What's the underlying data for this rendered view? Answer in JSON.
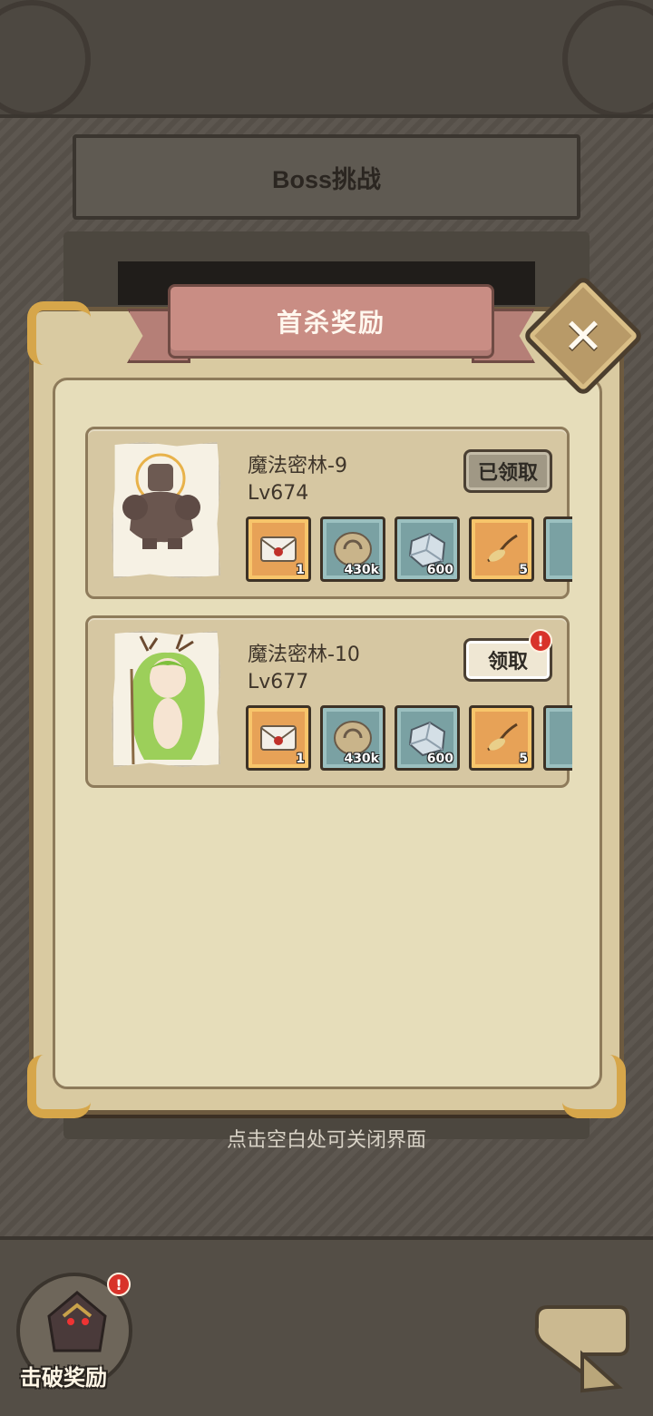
{
  "header": {
    "title": "Boss挑战"
  },
  "modal": {
    "title": "首杀奖励",
    "close_icon": "close-icon",
    "hint": "点击空白处可关闭界面"
  },
  "rewards": [
    {
      "stage": "魔法密林-9",
      "level": "Lv674",
      "button": "已领取",
      "state": "claimed",
      "boss": "stone-golem",
      "items": [
        {
          "icon": "letter-icon",
          "count": "1",
          "frame": "gold"
        },
        {
          "icon": "coin-icon",
          "count": "430k",
          "frame": "teal"
        },
        {
          "icon": "crystal-icon",
          "count": "600",
          "frame": "teal"
        },
        {
          "icon": "root-icon",
          "count": "5",
          "frame": "gold"
        }
      ]
    },
    {
      "stage": "魔法密林-10",
      "level": "Lv677",
      "button": "领取",
      "state": "claimable",
      "badge": "!",
      "boss": "forest-dryad",
      "items": [
        {
          "icon": "letter-icon",
          "count": "1",
          "frame": "gold"
        },
        {
          "icon": "coin-icon",
          "count": "430k",
          "frame": "teal"
        },
        {
          "icon": "crystal-icon",
          "count": "600",
          "frame": "teal"
        },
        {
          "icon": "root-icon",
          "count": "5",
          "frame": "gold"
        }
      ]
    }
  ],
  "bottom": {
    "kill_reward_label": "击破奖励",
    "kill_reward_badge": "!",
    "back_icon": "back-arrow-icon"
  },
  "colors": {
    "ribbon": "#c98d84",
    "gold_frame": "#e7a257",
    "teal_frame": "#7aa1a3",
    "badge": "#d8322a"
  }
}
